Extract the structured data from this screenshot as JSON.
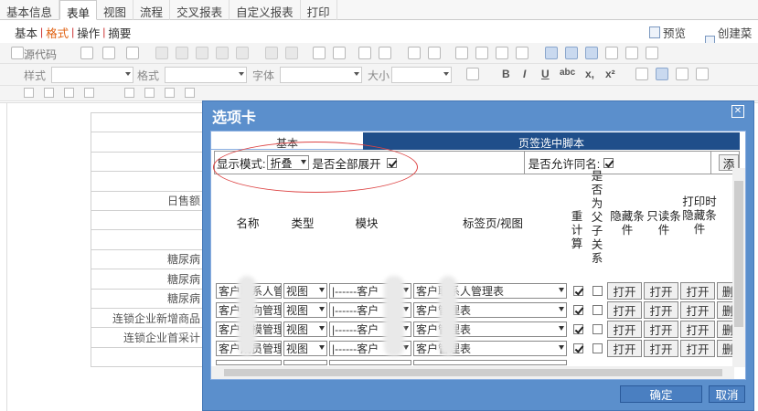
{
  "top_tabs": [
    "基本信息",
    "表单",
    "视图",
    "流程",
    "交叉报表",
    "自定义报表",
    "打印"
  ],
  "active_top_tab": "表单",
  "sub_tabs": [
    "基本",
    "格式",
    "操作",
    "摘要"
  ],
  "active_sub_tab": "格式",
  "sub_actions": {
    "preview": "预览",
    "create_menu": "创建菜单"
  },
  "toolbar": {
    "source": "源代码",
    "style_label": "样式",
    "format_label": "格式",
    "font_label": "字体",
    "size_label": "大小"
  },
  "sheet_rows": [
    "",
    "",
    "",
    "",
    "日售额",
    "",
    "",
    "糖尿病",
    "糖尿病",
    "糖尿病",
    "连锁企业新增商品",
    "连锁企业首采计",
    ""
  ],
  "dialog": {
    "title": "选项卡",
    "tabs": [
      "基本",
      "页签选中脚本"
    ],
    "display_mode_label": "显示模式:",
    "display_mode_value": "折叠",
    "expand_all_label": "是否全部展开",
    "expand_all_checked": true,
    "allow_same_name_label": "是否允许同名:",
    "allow_same_name_checked": true,
    "add_button": "添",
    "columns": [
      "名称",
      "类型",
      "模块",
      "标签页/视图",
      "重计算",
      "是否为父子关系",
      "隐藏条件",
      "只读条件",
      "打印时隐藏条件"
    ],
    "rows": [
      {
        "name": "客户联系人管",
        "type": "视图",
        "module": "|------客户",
        "view": "客户联系人管理表",
        "recalc": true,
        "parent": false
      },
      {
        "name": "客户方向管理",
        "type": "视图",
        "module": "|------客户",
        "view": "客户管理表",
        "recalc": true,
        "parent": false
      },
      {
        "name": "客户规模管理",
        "type": "视图",
        "module": "|------客户",
        "view": "客户管理表",
        "recalc": true,
        "parent": false
      },
      {
        "name": "客户成员管理",
        "type": "视图",
        "module": "|------客户",
        "view": "客户管理表",
        "recalc": true,
        "parent": false
      }
    ],
    "open_label": "打开",
    "delete_label": "删",
    "ok_button": "确定",
    "cancel_button": "取消"
  }
}
